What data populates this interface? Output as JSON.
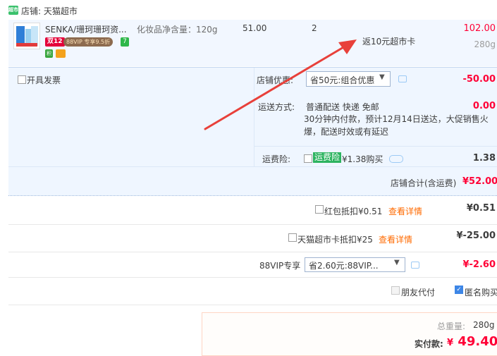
{
  "store": {
    "label": "店铺: 天猫超市",
    "icon": "tmall-supermarket-icon"
  },
  "product": {
    "name": "SENKA/珊珂珊珂资...",
    "sku": "化妆品净含量：120g",
    "unit_price": "51.00",
    "quantity": "2",
    "total": "102.00",
    "weight": "280g",
    "badge_double12": "双12",
    "badge_vip": "88VIP 专享9.5折",
    "badge_7day": "7",
    "cashback": "返10元超市卡"
  },
  "options": {
    "invoice_label": "开具发票",
    "discount_label": "店铺优惠:",
    "discount_selected": "省50元:组合优惠",
    "discount_amount": "-50.00",
    "shipping_label": "运送方式:",
    "shipping_method": "普通配送 快递 免邮",
    "shipping_note_1": "30分钟内付款，预计12月14日送达，大促销售火",
    "shipping_note_2": "爆，配送时效或有延迟",
    "shipping_fee": "0.00",
    "insurance_label": "运费险:",
    "insurance_badge": "运费险",
    "insurance_price": "¥1.38购买",
    "insurance_amount": "1.38",
    "store_total_label": "店铺合计(含运费)",
    "store_total_value": "¥52.00"
  },
  "order": {
    "redpacket_label": "红包抵扣¥0.51",
    "redpacket_link": "查看详情",
    "redpacket_amount": "¥0.51",
    "card_label": "天猫超市卡抵扣¥25",
    "card_link": "查看详情",
    "card_amount": "¥-25.00",
    "vip_label": "88VIP专享",
    "vip_selected": "省2.60元:88VIP...",
    "vip_amount": "¥-2.60",
    "friendpay_label": "朋友代付",
    "anon_label": "匿名购买",
    "anon_checked": true
  },
  "summary": {
    "weight_label": "总重量:",
    "weight_value": "280g",
    "pay_label": "实付款:",
    "pay_currency": "¥",
    "pay_value": "49.40"
  },
  "colors": {
    "price_red": "#ff0036",
    "link_orange": "#ff6a00",
    "option_bg": "#eff6ff",
    "arrow": "#e8403a"
  }
}
